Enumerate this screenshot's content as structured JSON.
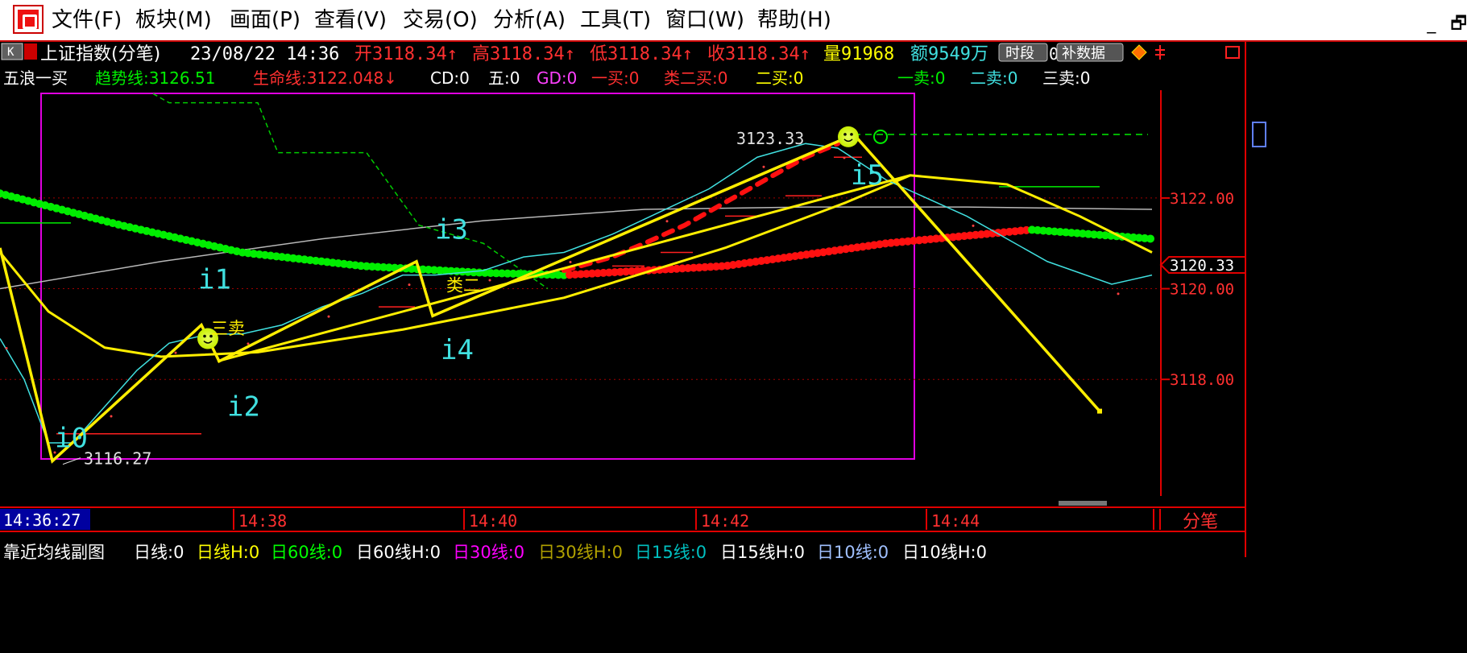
{
  "menu": {
    "items": [
      "文件(F)",
      "板块(M)",
      "画面(P)",
      "查看(V)",
      "交易(O)",
      "分析(A)",
      "工具(T)",
      "窗口(W)",
      "帮助(H)"
    ],
    "win_minimize": "_",
    "win_restore": "🗗"
  },
  "header": {
    "k_label": "K",
    "title": "上证指数(分笔)",
    "datetime": "23/08/22 14:36",
    "open": "开3118.34↑",
    "high": "高3118.34↑",
    "low": "低3118.34↑",
    "close": "收3118.34↑",
    "volume": "量91968",
    "amount": "额9549万",
    "btn_period": "时段",
    "zero": "0",
    "btn_supplement": "补数据"
  },
  "indicator": {
    "name": "五浪一买",
    "trend": "趋势线:3126.51",
    "life": "生命线:3122.048↓",
    "cd": "CD:0",
    "five": "五:0",
    "gd": "GD:0",
    "buy1": "一买:0",
    "class_buy2": "类二买:0",
    "buy2": "二买:0",
    "sell1": "一卖:0",
    "sell2": "二卖:0",
    "sell3": "三卖:0"
  },
  "chart_data": {
    "type": "line",
    "title": "上证指数(分笔)",
    "x_ticks": [
      "14:38",
      "14:40",
      "14:42",
      "14:44"
    ],
    "cursor_time": "14:36:27",
    "y_ticks": [
      3122.0,
      3120.0,
      3118.0
    ],
    "current_price": "3120.33",
    "ylim": [
      3115.5,
      3124.2
    ],
    "high_label": "3123.33",
    "low_label": "3116.27",
    "wave_labels": [
      "i0",
      "i1",
      "i2",
      "i3",
      "i4",
      "i5"
    ],
    "annotations": [
      "三卖",
      "类二"
    ],
    "price_series": [
      3118.9,
      3118.0,
      3116.6,
      3116.6,
      3117.4,
      3118.2,
      3118.8,
      3119.0,
      3119.0,
      3119.2,
      3119.6,
      3119.9,
      3120.3,
      3120.3,
      3120.4,
      3120.7,
      3120.8,
      3121.2,
      3121.7,
      3122.2,
      3122.9,
      3123.2,
      3123.1,
      3122.4,
      3121.6,
      3120.6,
      3120.1,
      3120.3
    ],
    "price_x": [
      0,
      30,
      60,
      90,
      130,
      170,
      210,
      260,
      300,
      350,
      400,
      450,
      500,
      540,
      600,
      650,
      700,
      760,
      820,
      880,
      940,
      1000,
      1040,
      1100,
      1200,
      1300,
      1380,
      1430
    ],
    "zigzag": [
      {
        "x": 0,
        "v": 3120.9
      },
      {
        "x": 65,
        "v": 3116.2
      },
      {
        "x": 250,
        "v": 3119.2
      },
      {
        "x": 272,
        "v": 3118.4
      },
      {
        "x": 517,
        "v": 3120.6
      },
      {
        "x": 537,
        "v": 3119.4
      },
      {
        "x": 1060,
        "v": 3123.4
      },
      {
        "x": 1365,
        "v": 3117.3
      }
    ],
    "channel_upper": [
      {
        "x": 537,
        "v": 3119.4
      },
      {
        "x": 1060,
        "v": 3123.4
      }
    ],
    "channel_lower": [
      {
        "x": 270,
        "v": 3118.4
      },
      {
        "x": 1130,
        "v": 3122.5
      }
    ],
    "ma_fast": [
      {
        "x": 0,
        "v": 3120.8
      },
      {
        "x": 60,
        "v": 3119.5
      },
      {
        "x": 130,
        "v": 3118.7
      },
      {
        "x": 200,
        "v": 3118.5
      },
      {
        "x": 320,
        "v": 3118.6
      },
      {
        "x": 500,
        "v": 3119.1
      },
      {
        "x": 700,
        "v": 3119.8
      },
      {
        "x": 900,
        "v": 3120.9
      },
      {
        "x": 1050,
        "v": 3121.9
      },
      {
        "x": 1130,
        "v": 3122.5
      },
      {
        "x": 1250,
        "v": 3122.3
      },
      {
        "x": 1340,
        "v": 3121.6
      },
      {
        "x": 1430,
        "v": 3120.8
      }
    ],
    "ma_slow": [
      {
        "x": 0,
        "v": 3120.0
      },
      {
        "x": 200,
        "v": 3120.6
      },
      {
        "x": 400,
        "v": 3121.1
      },
      {
        "x": 600,
        "v": 3121.5
      },
      {
        "x": 800,
        "v": 3121.75
      },
      {
        "x": 1000,
        "v": 3121.8
      },
      {
        "x": 1200,
        "v": 3121.8
      },
      {
        "x": 1430,
        "v": 3121.75
      }
    ],
    "life_dots": [
      {
        "x": 0,
        "v": 3122.1
      },
      {
        "x": 150,
        "v": 3121.4
      },
      {
        "x": 300,
        "v": 3120.8
      },
      {
        "x": 450,
        "v": 3120.5
      },
      {
        "x": 600,
        "v": 3120.35
      },
      {
        "x": 700,
        "v": 3120.3
      },
      {
        "x": 900,
        "v": 3120.5
      },
      {
        "x": 1100,
        "v": 3121.0
      },
      {
        "x": 1280,
        "v": 3121.3
      },
      {
        "x": 1430,
        "v": 3121.1
      }
    ],
    "trend_dashed": [
      {
        "x": 190,
        "v": 3124.3
      },
      {
        "x": 210,
        "v": 3124.1
      },
      {
        "x": 320,
        "v": 3124.1
      },
      {
        "x": 345,
        "v": 3123.0
      },
      {
        "x": 455,
        "v": 3123.0
      },
      {
        "x": 520,
        "v": 3121.4
      },
      {
        "x": 600,
        "v": 3121.0
      },
      {
        "x": 680,
        "v": 3120.0
      }
    ]
  },
  "bottom": {
    "period_label": "分笔",
    "subchart_name": "靠近均线副图",
    "items": [
      "日线:0",
      "日线H:0",
      "日60线:0",
      "日60线H:0",
      "日30线:0",
      "日30线H:0",
      "日15线:0",
      "日15线H:0",
      "日10线:0",
      "日10线H:0"
    ],
    "item_colors": [
      "#ffffff",
      "#ffff00",
      "#00ff00",
      "#ffffff",
      "#ff00ff",
      "#b0a000",
      "#00c0c0",
      "#ffffff",
      "#a0c0ff",
      "#ffffff"
    ]
  },
  "colors": {
    "up": "#ff3030",
    "axis": "#e00000",
    "price": "#40e0e0",
    "zigzag": "#ffee00",
    "life_green": "#00ee00",
    "life_red": "#ff1010",
    "box": "#e000e0"
  }
}
